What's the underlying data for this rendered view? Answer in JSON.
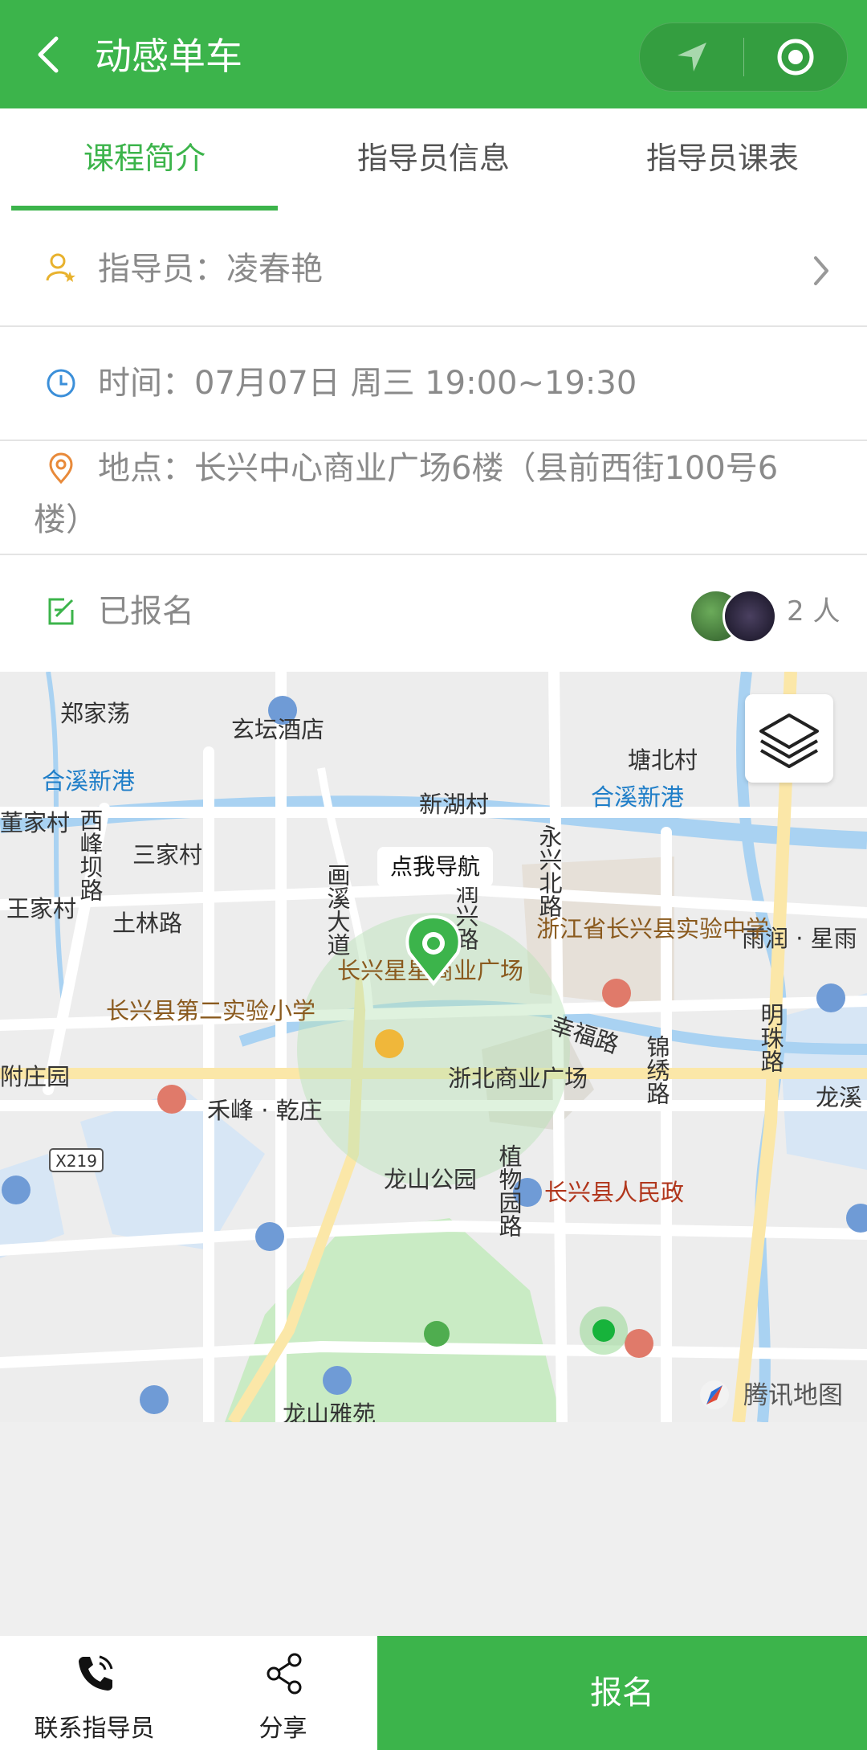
{
  "app": {
    "title": "动感单车",
    "accent_color": "#3cb44b"
  },
  "header": {
    "back_icon": "chevron-left-icon",
    "nav_icon": "location-arrow-icon",
    "close_icon": "target-icon"
  },
  "tabs": [
    {
      "label": "课程简介",
      "active": true
    },
    {
      "label": "指导员信息",
      "active": false
    },
    {
      "label": "指导员课表",
      "active": false
    }
  ],
  "info": {
    "instructor": "指导员：凌春艳",
    "time": "时间：07月07日 周三 19:00~19:30",
    "location_line1": "地点：长兴中心商业广场6楼（县前西街100号6",
    "location_line2": "楼）",
    "registered_label": "已报名",
    "registered_count": "2 人"
  },
  "map": {
    "nav_bubble": "点我导航",
    "labels": {
      "zhengjiadang": "郑家荡",
      "xuantan_hotel": "玄坛酒店",
      "tangbei_village": "塘北村",
      "hexi_port_1": "合溪新港",
      "hexi_port_2": "合溪新港",
      "xinhu_village": "新湖村",
      "dongjia_village": "董家村",
      "xifeng_dam_road": "西峰坝路",
      "sanjia_village": "三家村",
      "huaxi_avenue": "画溪大道",
      "yongxing_north_road": "永兴北路",
      "runxing_road": "润兴路",
      "wangjia_village": "王家村",
      "shilin_road": "土林路",
      "experimental_school": "浙江省长兴县实验中学",
      "yurun_star": "雨润 · 星雨",
      "xingxing_plaza": "长兴星星商业广场",
      "second_primary": "长兴县第二实验小学",
      "xingfu_road": "幸福路",
      "jinxiu_road": "锦绣路",
      "mingzhu_road": "明珠路",
      "fuzhuang_garden": "附庄园",
      "zhebei_plaza": "浙北商业广场",
      "longxi": "龙溪",
      "hefeng_qianzhuang": "禾峰 · 乾庄",
      "x219": "X219",
      "longshan_park": "龙山公园",
      "zhiwuyuan_road": "植物园路",
      "peoples_gov": "长兴县人民政",
      "longshan_yayuan": "龙山雅苑",
      "tencent_map": "腾讯地图"
    }
  },
  "bottom": {
    "contact_label": "联系指导员",
    "share_label": "分享",
    "signup_label": "报名"
  }
}
